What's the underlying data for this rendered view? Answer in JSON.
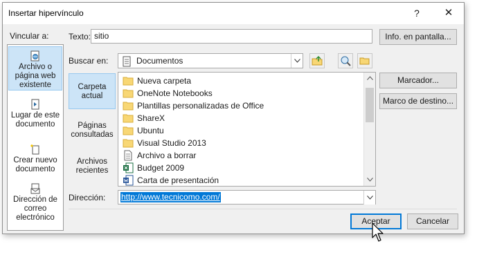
{
  "dialog": {
    "title": "Insertar hipervínculo",
    "help_label": "?",
    "close_label": "✕"
  },
  "link_to": {
    "label": "Vincular a:",
    "items": [
      {
        "lines": [
          "Archivo o",
          "página web",
          "existente"
        ],
        "icon": "web-page-icon",
        "selected": true
      },
      {
        "lines": [
          "Lugar de este",
          "documento"
        ],
        "icon": "place-in-document-icon",
        "selected": false
      },
      {
        "lines": [
          "Crear nuevo",
          "documento"
        ],
        "icon": "new-document-icon",
        "selected": false
      },
      {
        "lines": [
          "Dirección de",
          "correo",
          "electrónico"
        ],
        "icon": "email-icon",
        "selected": false
      }
    ]
  },
  "text_field": {
    "label": "Texto:",
    "value": "sitio"
  },
  "screentip_button": "Info. en pantalla...",
  "look_in": {
    "label": "Buscar en:",
    "value": "Documentos"
  },
  "side_tabs": [
    {
      "lines": [
        "Carpeta",
        "actual"
      ],
      "selected": true
    },
    {
      "lines": [
        "Páginas",
        "consultadas"
      ],
      "selected": false
    },
    {
      "lines": [
        "Archivos",
        "recientes"
      ],
      "selected": false
    }
  ],
  "files": [
    {
      "name": "Nueva carpeta",
      "type": "folder"
    },
    {
      "name": "OneNote Notebooks",
      "type": "folder"
    },
    {
      "name": "Plantillas personalizadas de Office",
      "type": "folder"
    },
    {
      "name": "ShareX",
      "type": "folder"
    },
    {
      "name": "Ubuntu",
      "type": "folder"
    },
    {
      "name": "Visual Studio 2013",
      "type": "folder"
    },
    {
      "name": "Archivo a borrar",
      "type": "text"
    },
    {
      "name": "Budget 2009",
      "type": "excel"
    },
    {
      "name": "Carta de presentación",
      "type": "word"
    }
  ],
  "bookmark_button": "Marcador...",
  "target_frame_button": "Marco de destino...",
  "address": {
    "label": "Dirección:",
    "value": "http://www.tecnicomo.com/"
  },
  "ok_button": "Aceptar",
  "cancel_button": "Cancelar",
  "colors": {
    "accent": "#0078d7",
    "selection": "#cce4f7",
    "folder": "#f8d775"
  }
}
